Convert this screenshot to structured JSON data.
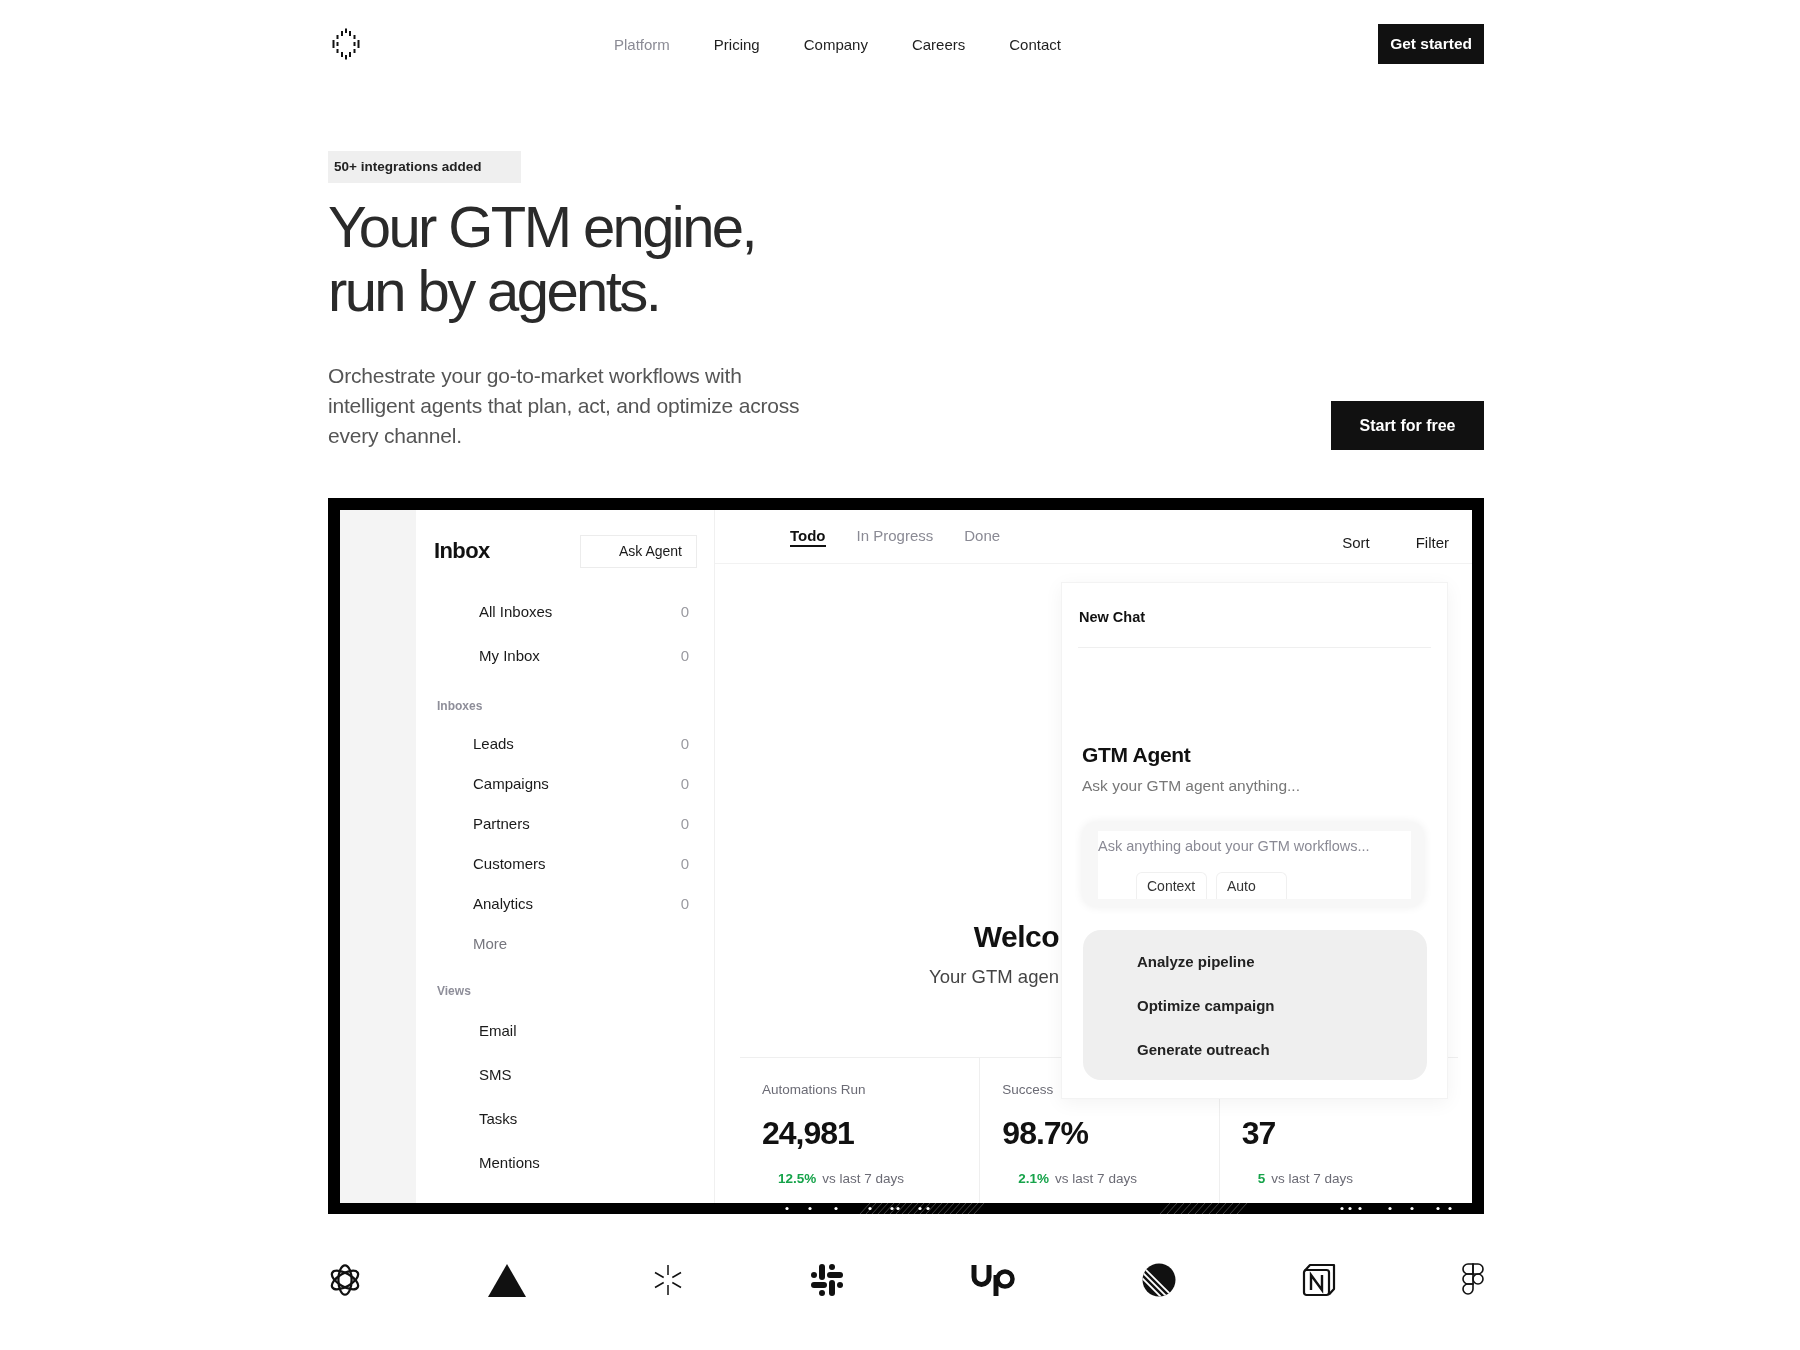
{
  "nav": {
    "items": [
      {
        "label": "Platform",
        "selected": true
      },
      {
        "label": "Pricing",
        "selected": false
      },
      {
        "label": "Company",
        "selected": false
      },
      {
        "label": "Careers",
        "selected": false
      },
      {
        "label": "Contact",
        "selected": false
      }
    ],
    "cta": "Get started"
  },
  "hero": {
    "badge": "50+ integrations added",
    "headline_lines": [
      "Your GTM engine,",
      "run by agents."
    ],
    "subtitle": "Orchestrate your go-to-market workflows with intelligent agents that plan, act, and optimize across every channel.",
    "cta": "Start for free"
  },
  "app": {
    "sidebar": {
      "title": "Inbox",
      "action": "Ask Agent",
      "items": [
        {
          "label": "All Inboxes",
          "count": "0"
        },
        {
          "label": "My Inbox",
          "count": "0"
        }
      ],
      "sections": [
        {
          "heading": "Inboxes",
          "items": [
            {
              "label": "Leads",
              "count": "0"
            },
            {
              "label": "Campaigns",
              "count": "0"
            },
            {
              "label": "Partners",
              "count": "0"
            },
            {
              "label": "Customers",
              "count": "0"
            },
            {
              "label": "Analytics",
              "count": "0"
            }
          ],
          "more": "More"
        },
        {
          "heading": "Views",
          "items": [
            {
              "label": "Email"
            },
            {
              "label": "SMS"
            },
            {
              "label": "Tasks"
            },
            {
              "label": "Mentions"
            }
          ]
        }
      ]
    },
    "tabs": [
      {
        "label": "Todo",
        "selected": true
      },
      {
        "label": "In Progress",
        "selected": false
      },
      {
        "label": "Done",
        "selected": false
      }
    ],
    "actions": [
      "Sort",
      "Filter"
    ],
    "welcome": {
      "title": "Welco",
      "subtitle": "Your GTM agen"
    },
    "stats": [
      {
        "label": "Automations Run",
        "value": "24,981",
        "change": "12.5%",
        "comparison": "vs last 7 days"
      },
      {
        "label": "Success",
        "value": "98.7%",
        "change": "2.1%",
        "comparison": "vs last 7 days"
      },
      {
        "value": "37",
        "change": "5",
        "comparison": "vs last 7 days"
      }
    ],
    "chat": {
      "title": "New Chat",
      "agent_name": "GTM Agent",
      "agent_prompt": "Ask your GTM agent anything...",
      "input": {
        "placeholder": "Ask anything about your GTM workflows..."
      },
      "chips": [
        "Context",
        "Auto"
      ],
      "suggestions": [
        "Analyze pipeline",
        "Optimize campaign",
        "Generate outreach"
      ]
    }
  }
}
